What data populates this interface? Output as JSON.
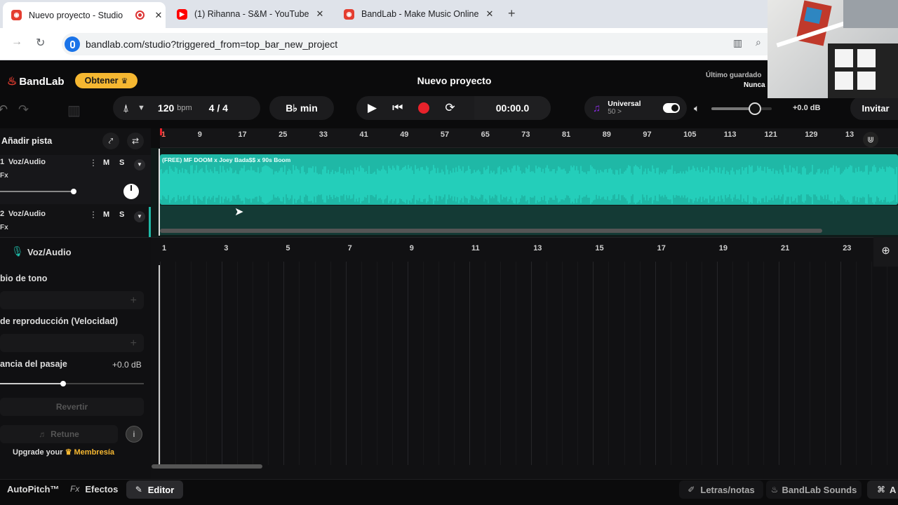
{
  "browser": {
    "tabs": [
      {
        "title": "Nuevo proyecto - Studio",
        "icon": "bandlab-icon",
        "recording": true
      },
      {
        "title": "(1) Rihanna - S&M - YouTube",
        "icon": "youtube-icon"
      },
      {
        "title": "BandLab - Make Music Online",
        "icon": "bandlab-icon"
      }
    ],
    "new_tab": "+",
    "url": "bandlab.com/studio?triggered_from=top_bar_new_project"
  },
  "header": {
    "logo": "BandLab",
    "get_button": "Obtener",
    "project_title": "Nuevo proyecto",
    "last_saved_label": "Último guardado",
    "last_saved_value": "Nunca"
  },
  "toolbar": {
    "tempo": "120",
    "tempo_unit": "bpm",
    "time_sig": "4 / 4",
    "key": "B♭ min",
    "time": "00:00.0",
    "universal_label": "Universal",
    "universal_value": "50 >",
    "volume_db": "+0.0 dB",
    "invite": "Invitar",
    "volume_level": 0.72
  },
  "ruler": {
    "marks": [
      "1",
      "9",
      "17",
      "25",
      "33",
      "41",
      "49",
      "57",
      "65",
      "73",
      "81",
      "89",
      "97",
      "105",
      "113",
      "121",
      "129",
      "13"
    ]
  },
  "tracks": {
    "add_track": "Añadir pista",
    "items": [
      {
        "number": "1",
        "name": "Voz/Audio",
        "fx": "Fx",
        "mute": "M",
        "solo": "S"
      },
      {
        "number": "2",
        "name": "Voz/Audio",
        "fx": "Fx",
        "mute": "M",
        "solo": "S"
      }
    ]
  },
  "clip": {
    "title": "(FREE) MF DOOM x Joey Bada$$ x 90s Boom"
  },
  "editor": {
    "track_name": "Voz/Audio",
    "pitch_label": "bio de tono",
    "playback_label": "de reproducción (Velocidad)",
    "gain_label": "ancia del pasaje",
    "gain_value": "+0.0 dB",
    "revert": "Revertir",
    "retune": "Retune",
    "upgrade_text": "Upgrade your",
    "membership": "Membresía",
    "ruler_marks": [
      "1",
      "3",
      "5",
      "7",
      "9",
      "11",
      "13",
      "15",
      "17",
      "19",
      "21",
      "23"
    ]
  },
  "bottom": {
    "autopitch": "AutoPitch™",
    "effects": "Efectos",
    "effects_prefix": "Fx",
    "editor": "Editor",
    "lyrics": "Letras/notas",
    "sounds": "BandLab Sounds",
    "right_cut": "A"
  },
  "colors": {
    "accent": "#1fb8a6",
    "brand": "#e43d30",
    "get_button": "#f5b731",
    "record": "#e8222b"
  }
}
